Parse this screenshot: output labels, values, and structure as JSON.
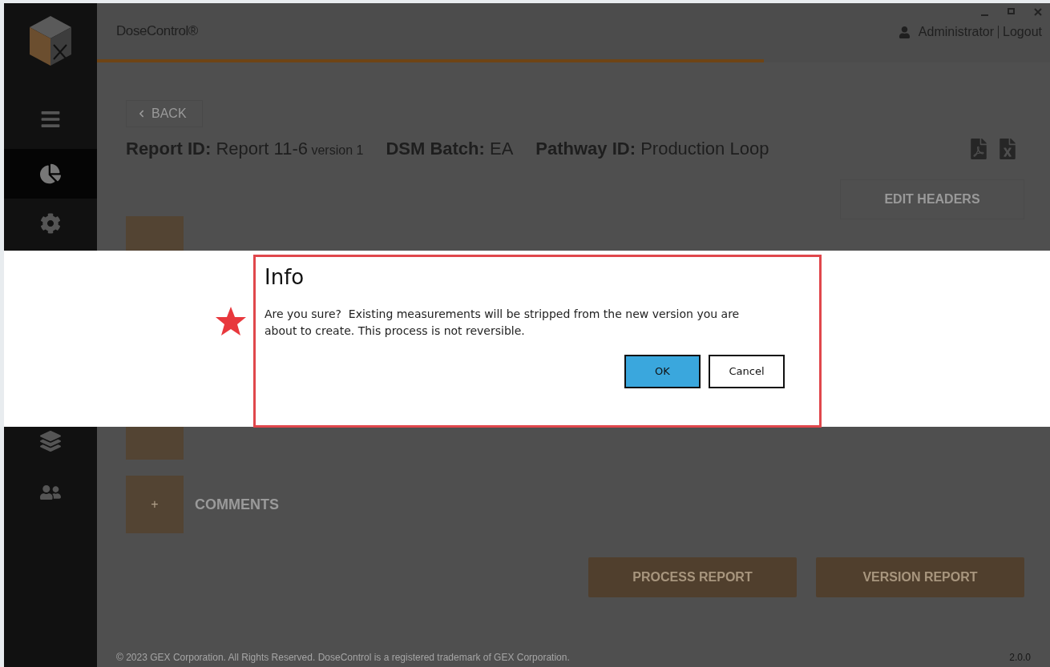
{
  "app": {
    "title": "DoseControl®",
    "user": "Administrator",
    "logout": "Logout",
    "progress": {
      "level": 0.7
    }
  },
  "sidebar": {
    "items": [
      {
        "selected": false
      },
      {
        "selected": true
      },
      {
        "selected": false
      },
      {
        "selected": false
      },
      {
        "selected": false
      }
    ]
  },
  "back": "BACK",
  "report": [
    {
      "label": "Report ID:",
      "value": "Report 11-6",
      "note": "version 1"
    },
    {
      "label": "DSM Batch:",
      "value": "EA"
    },
    {
      "label": "Pathway ID:",
      "value": "Production Loop"
    }
  ],
  "edit_headers": "EDIT HEADERS",
  "sections": [
    {
      "label": "COMMENTS",
      "plus": "+"
    }
  ],
  "actions": [
    "PROCESS REPORT",
    "VERSION REPORT"
  ],
  "footer": {
    "copyright": "© 2023 GEX Corporation. All Rights Reserved. DoseControl is a registered trademark of GEX Corporation.",
    "version": "2.0.0"
  },
  "dialog": {
    "title": "Info",
    "message": "Are you sure?  Existing measurements will be stripped from the new version you are about to create. This process is not reversible.",
    "buttons": [
      {
        "label": "OK",
        "primary": true
      },
      {
        "label": "Cancel",
        "primary": false
      }
    ]
  }
}
